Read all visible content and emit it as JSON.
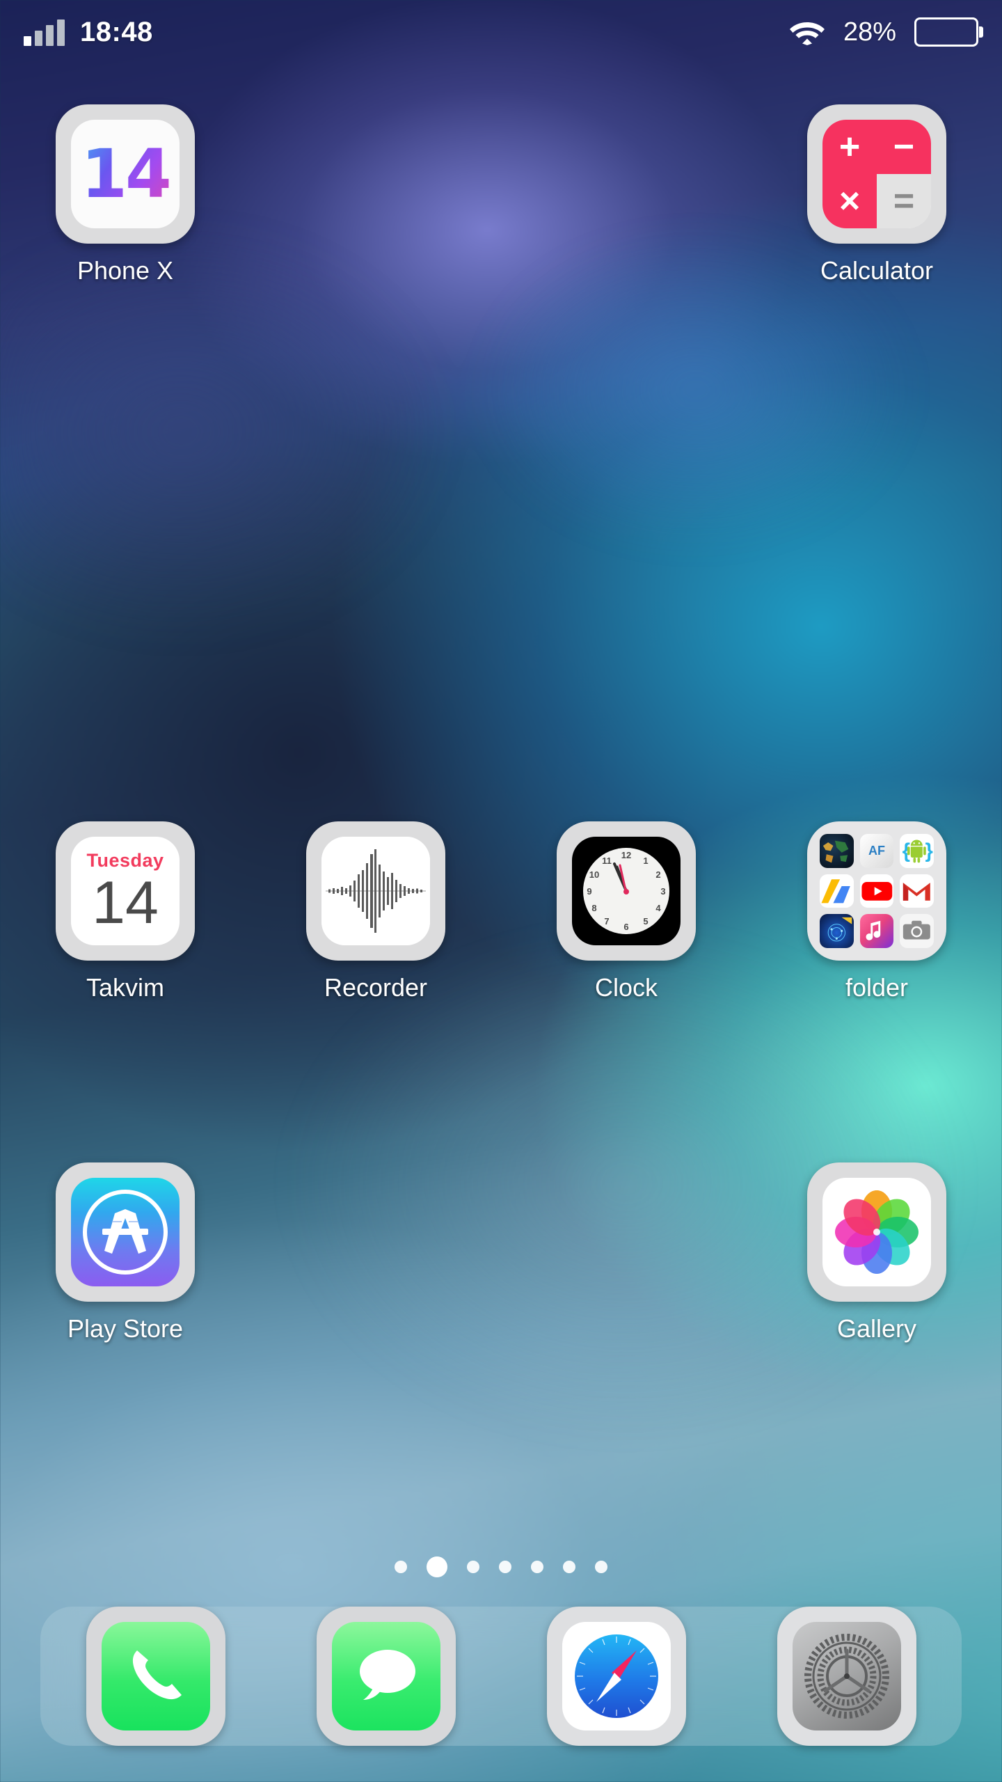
{
  "status_bar": {
    "time": "18:48",
    "battery_percent": "28%",
    "battery_level": 28,
    "signal_icon": "signal-bars-icon",
    "wifi_icon": "wifi-icon",
    "battery_icon": "battery-icon"
  },
  "home": {
    "rows": [
      {
        "cells": [
          {
            "name": "phone-x",
            "label": "Phone X",
            "icon": "ios14-icon",
            "empty": false
          },
          {
            "name": "empty-1",
            "label": "",
            "icon": "",
            "empty": true
          },
          {
            "name": "empty-2",
            "label": "",
            "icon": "",
            "empty": true
          },
          {
            "name": "calculator",
            "label": "Calculator",
            "icon": "calculator-icon",
            "empty": false
          }
        ]
      },
      {
        "cells": [
          {
            "name": "takvim",
            "label": "Takvim",
            "icon": "calendar-icon",
            "empty": false
          },
          {
            "name": "recorder",
            "label": "Recorder",
            "icon": "waveform-icon",
            "empty": false
          },
          {
            "name": "clock",
            "label": "Clock",
            "icon": "clock-icon",
            "empty": false
          },
          {
            "name": "folder",
            "label": "folder",
            "icon": "folder-icon",
            "empty": false
          }
        ]
      },
      {
        "cells": [
          {
            "name": "play-store",
            "label": "Play Store",
            "icon": "appstore-icon",
            "empty": false
          },
          {
            "name": "empty-3",
            "label": "",
            "icon": "",
            "empty": true
          },
          {
            "name": "empty-4",
            "label": "",
            "icon": "",
            "empty": true
          },
          {
            "name": "gallery",
            "label": "Gallery",
            "icon": "photos-flower-icon",
            "empty": false
          }
        ]
      }
    ]
  },
  "calculator": {
    "keys": [
      "+",
      "−",
      "×",
      "="
    ],
    "accent_color": "#f6325f",
    "equals_color": "#e3e3e3"
  },
  "calendar": {
    "weekday": "Tuesday",
    "day": "14",
    "weekday_color": "#f23b5d"
  },
  "clock_icon": {
    "numerals": [
      "12",
      "1",
      "2",
      "3",
      "4",
      "5",
      "6",
      "7",
      "8",
      "9",
      "10",
      "11"
    ],
    "hour_hand_position": "11",
    "second_hand_color": "#e0295c"
  },
  "folder": {
    "label": "folder",
    "apps": [
      {
        "name": "world-map-icon",
        "glyph": ""
      },
      {
        "name": "af-camera-icon",
        "glyph": "AF"
      },
      {
        "name": "android-icon",
        "glyph": ""
      },
      {
        "name": "adsense-icon",
        "glyph": ""
      },
      {
        "name": "youtube-icon",
        "glyph": ""
      },
      {
        "name": "gmail-icon",
        "glyph": "M"
      },
      {
        "name": "network-globe-icon",
        "glyph": ""
      },
      {
        "name": "music-player-icon",
        "glyph": ""
      },
      {
        "name": "camera-icon",
        "glyph": ""
      }
    ]
  },
  "page_indicator": {
    "total": 7,
    "active_index": 1
  },
  "dock": {
    "items": [
      {
        "name": "phone",
        "icon": "phone-handset-icon"
      },
      {
        "name": "messages",
        "icon": "speech-bubble-icon"
      },
      {
        "name": "safari",
        "icon": "compass-icon"
      },
      {
        "name": "settings",
        "icon": "gears-icon"
      }
    ]
  },
  "colors": {
    "wallpaper_top": "#1b2257",
    "wallpaper_bottom": "#2d7a90",
    "label_text": "#ffffff",
    "dock_background": "rgba(188,214,226,0.30)"
  }
}
